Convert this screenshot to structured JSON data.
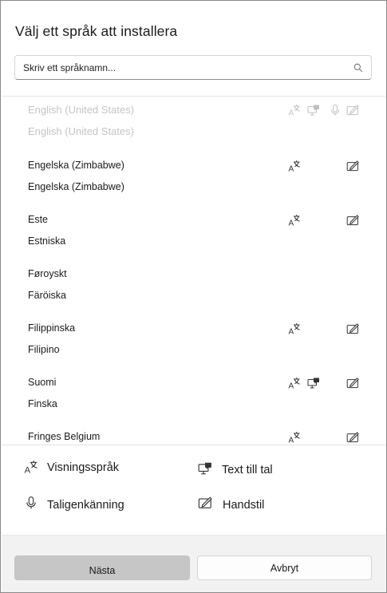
{
  "dialog": {
    "title": "Välj ett språk att installera",
    "search": {
      "placeholder": "Skriv ett språknamn..."
    }
  },
  "languages": [
    {
      "native": "English (United States)",
      "local": "English (United States)",
      "features": [
        "display",
        "tts",
        "speech",
        "handwriting"
      ],
      "faded": true
    },
    {
      "native": "Engelska (Zimbabwe)",
      "local": "Engelska (Zimbabwe)",
      "features": [
        "display",
        "handwriting"
      ]
    },
    {
      "native": "Este",
      "local": "Estniska",
      "features": [
        "display",
        "handwriting"
      ]
    },
    {
      "native": "Føroyskt",
      "local": "Färöiska",
      "features": []
    },
    {
      "native": "Filippinska",
      "local": "Filipino",
      "features": [
        "display",
        "handwriting"
      ]
    },
    {
      "native": "Suomi",
      "local": "Finska",
      "features": [
        "display",
        "tts",
        "handwriting"
      ]
    },
    {
      "native": "Fringes Belgium",
      "local": "",
      "features": [
        "display",
        "handwriting"
      ]
    }
  ],
  "legend": {
    "display": "Visningsspråk",
    "tts": "Text till tal",
    "speech": "Taligenkänning",
    "handwriting": "Handstil"
  },
  "icons": {
    "display": "display-language-icon",
    "tts": "text-to-speech-icon",
    "speech": "speech-recognition-icon",
    "handwriting": "handwriting-icon",
    "search": "search-icon"
  },
  "buttons": {
    "next": "Nästa",
    "cancel": "Avbryt"
  },
  "colors": {
    "next_bg": "#c6c6c6",
    "footer_bg": "#f2f2f2",
    "faded_text": "#c4c4c4"
  }
}
